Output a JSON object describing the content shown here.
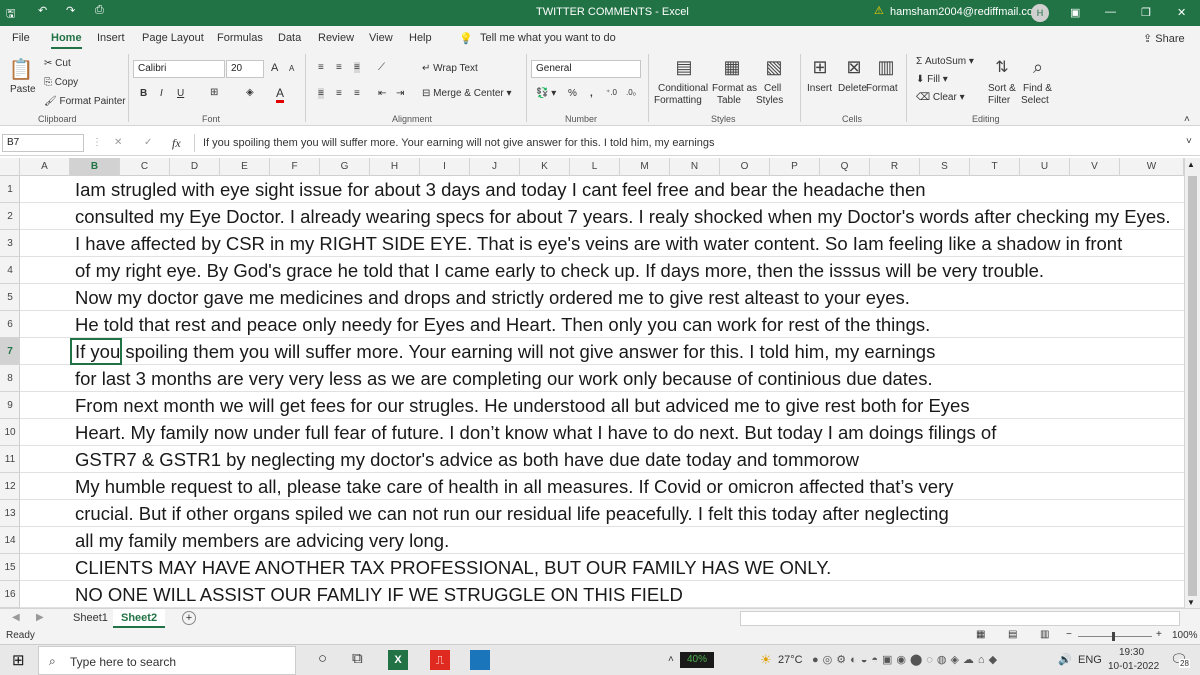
{
  "titlebar": {
    "doc_title": "TWITTER COMMENTS  -  Excel",
    "account": "hamsham2004@rediffmail.com",
    "avatar_letter": "H"
  },
  "tabs": [
    "File",
    "Home",
    "Insert",
    "Page Layout",
    "Formulas",
    "Data",
    "Review",
    "View",
    "Help"
  ],
  "tell_me": "Tell me what you want to do",
  "share": "Share",
  "ribbon": {
    "clipboard": {
      "paste": "Paste",
      "cut": "Cut",
      "copy": "Copy",
      "format_painter": "Format Painter",
      "group": "Clipboard"
    },
    "font": {
      "name": "Calibri",
      "size": "20",
      "bold": "B",
      "italic": "I",
      "underline": "U",
      "grow": "A",
      "shrink": "A",
      "font_color": "A",
      "group": "Font"
    },
    "alignment": {
      "wrap_text": "Wrap Text",
      "merge_center": "Merge & Center",
      "group": "Alignment"
    },
    "number": {
      "format": "General",
      "percent": "%",
      "comma": ",",
      "group": "Number"
    },
    "styles": {
      "conditional": "Conditional",
      "formatting": "Formatting",
      "format_as": "Format as",
      "table": "Table",
      "cell": "Cell",
      "styles": "Styles",
      "group": "Styles"
    },
    "cells": {
      "insert": "Insert",
      "delete": "Delete",
      "format": "Format",
      "group": "Cells"
    },
    "editing": {
      "autosum": "AutoSum",
      "fill": "Fill",
      "clear": "Clear",
      "sort1": "Sort &",
      "sort2": "Filter",
      "find1": "Find &",
      "find2": "Select",
      "group": "Editing"
    }
  },
  "formula_bar": {
    "name_box": "B7",
    "fx": "fx",
    "cancel": "✕",
    "enter": "✓",
    "content": "If you spoiling them you will suffer more. Your earning will not give answer for this. I told him, my earnings"
  },
  "columns": [
    "A",
    "B",
    "C",
    "D",
    "E",
    "F",
    "G",
    "H",
    "I",
    "J",
    "K",
    "L",
    "M",
    "N",
    "O",
    "P",
    "Q",
    "R",
    "S",
    "T",
    "U",
    "V",
    "W"
  ],
  "rows": [
    "1",
    "2",
    "3",
    "4",
    "5",
    "6",
    "7",
    "8",
    "9",
    "10",
    "11",
    "12",
    "13",
    "14",
    "15",
    "16"
  ],
  "cells": [
    "Iam strugled with eye sight issue for about 3 days and today I cant feel free and bear the headache then",
    "consulted my Eye Doctor. I already wearing specs for about 7 years. I realy shocked when my Doctor's words after checking my Eyes.",
    " I have affected by CSR in my RIGHT SIDE EYE. That is eye's veins are with water content. So Iam feeling like a shadow in front",
    "of my right eye. By God's grace he told that I came early to check up. If days more, then the isssus will be very trouble.",
    "Now my doctor gave me medicines and drops and strictly ordered me to give rest alteast to your eyes.",
    "He told that rest and peace only needy for Eyes and Heart. Then only you can work for rest of the things.",
    "If you spoiling them you will suffer more. Your earning will not give answer for this. I told him, my earnings",
    "for last 3 months are very very less as we are completing our work only because of continious due dates.",
    "From next month we will get fees for our strugles. He understood all but adviced me to give rest both  for Eyes",
    "Heart. My family now under full fear of future. I don’t know what I have to do next. But today I am doings filings of",
    "GSTR7 & GSTR1 by neglecting my doctor's advice as both have due date today and tommorow",
    "My humble request to all, please take care of health in all measures. If Covid or omicron affected that’s very",
    "crucial. But if other organs spiled we can not run our residual life peacefully. I felt this today after neglecting",
    "all my family members are advicing very long.",
    "CLIENTS MAY HAVE ANOTHER TAX PROFESSIONAL, BUT OUR FAMILY HAS WE ONLY.",
    "NO ONE WILL ASSIST OUR FAMLIY IF WE STRUGGLE ON THIS FIELD"
  ],
  "sheets": [
    "Sheet1",
    "Sheet2"
  ],
  "status": {
    "ready": "Ready",
    "zoom": "100%"
  },
  "taskbar": {
    "search": "Type here to search",
    "battery": "40%",
    "temp": "27°C",
    "lang": "ENG",
    "time": "19:30",
    "date": "10-01-2022",
    "notif": "28"
  },
  "colors": {
    "excel_green": "#217346"
  }
}
